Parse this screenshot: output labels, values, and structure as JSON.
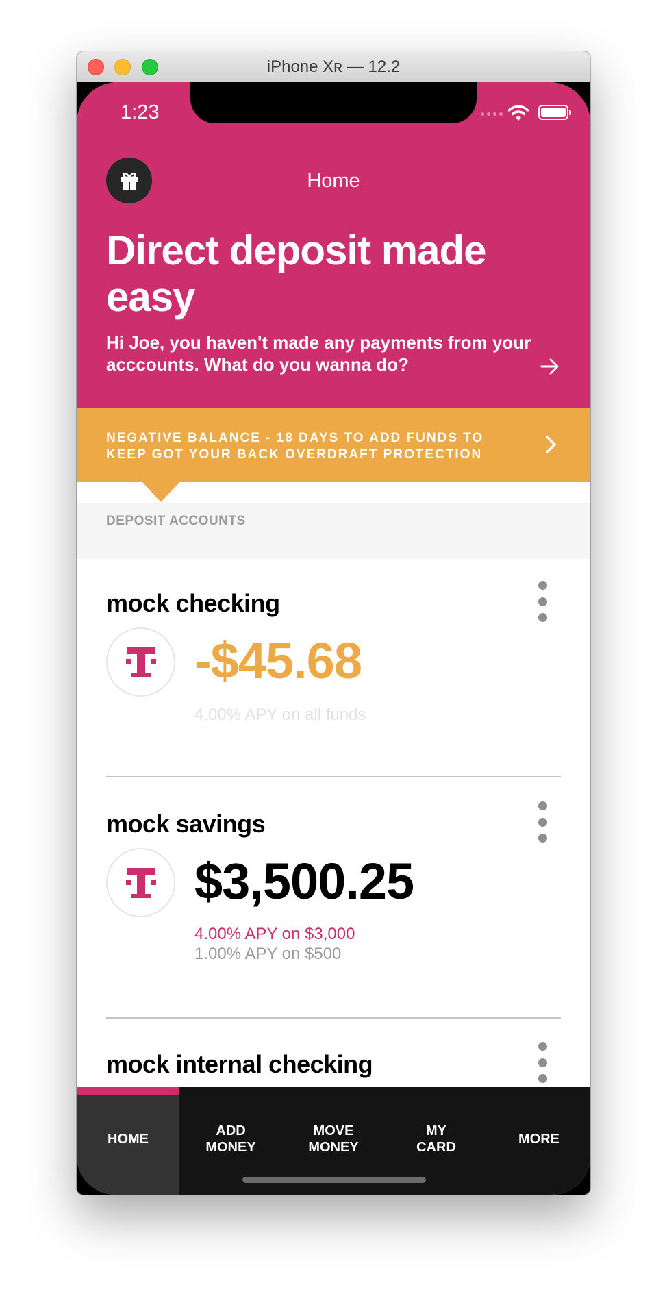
{
  "window": {
    "title": "iPhone Xʀ — 12.2"
  },
  "status_bar": {
    "time": "1:23"
  },
  "nav": {
    "title": "Home"
  },
  "hero": {
    "title": "Direct deposit made easy",
    "subtitle": "Hi Joe, you haven't made any payments from your acccounts. What do you wanna do?"
  },
  "alert": {
    "text": "NEGATIVE BALANCE - 18 DAYS TO ADD FUNDS TO KEEP GOT YOUR BACK OVERDRAFT PROTECTION"
  },
  "section": {
    "label": "DEPOSIT ACCOUNTS"
  },
  "accounts": [
    {
      "name": "mock checking",
      "balance": "-$45.68",
      "apy_primary": "4.00% APY on all funds",
      "apy_secondary": ""
    },
    {
      "name": "mock savings",
      "balance": "$3,500.25",
      "apy_primary": "4.00% APY on $3,000",
      "apy_secondary": "1.00% APY on $500"
    },
    {
      "name": "mock internal checking",
      "balance": "",
      "apy_primary": "",
      "apy_secondary": ""
    }
  ],
  "tabs": [
    {
      "label": "HOME",
      "active": true
    },
    {
      "label": "ADD\nMONEY",
      "active": false
    },
    {
      "label": "MOVE\nMONEY",
      "active": false
    },
    {
      "label": "MY\nCARD",
      "active": false
    },
    {
      "label": "MORE",
      "active": false
    }
  ],
  "colors": {
    "brand_magenta": "#cc2e6e",
    "warning_orange": "#eca946",
    "tab_bar": "#141414"
  }
}
